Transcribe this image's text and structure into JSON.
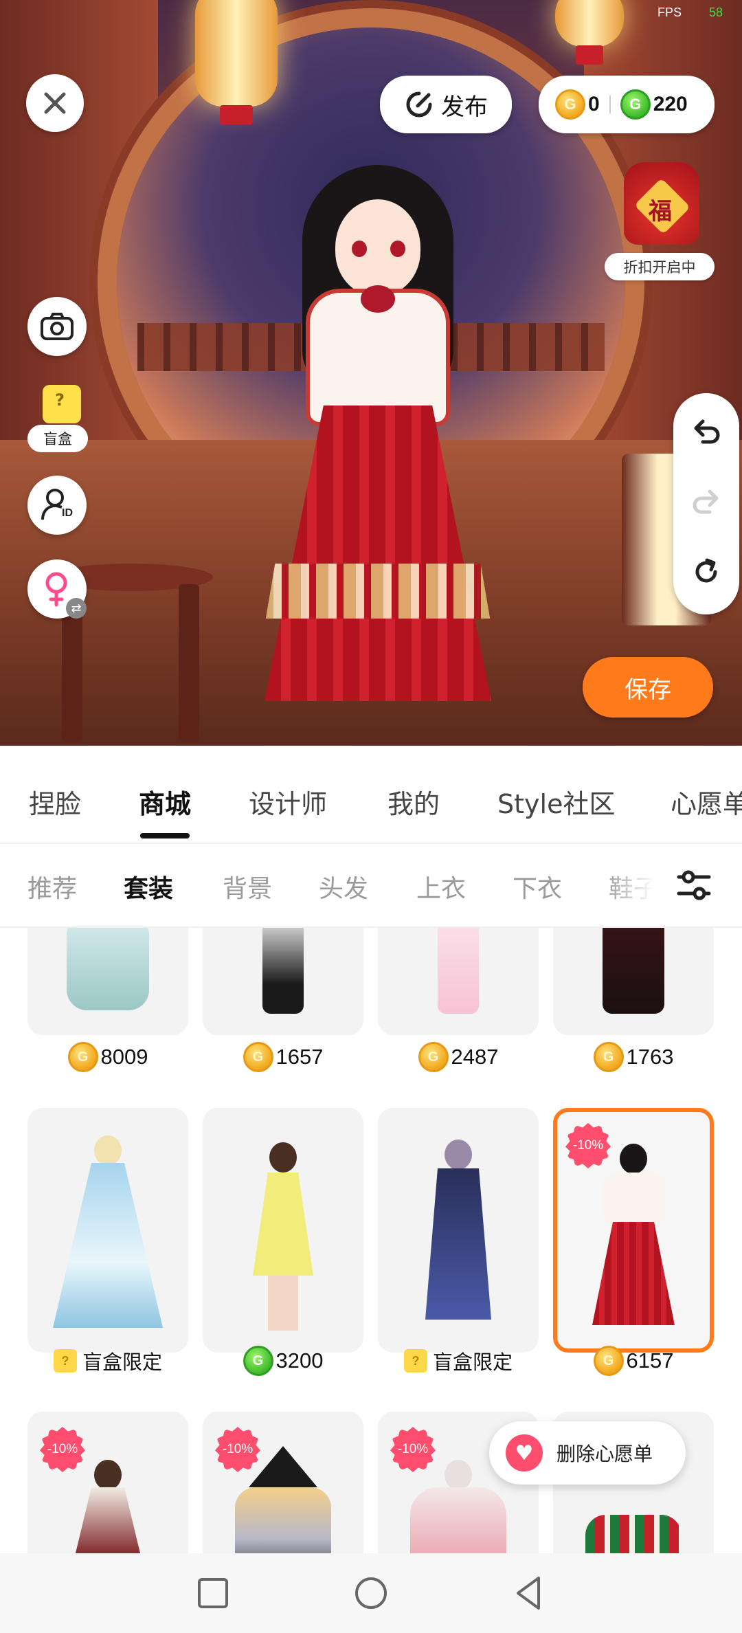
{
  "status": {
    "fps_label": "FPS",
    "fps_value": "58"
  },
  "top_bar": {
    "publish_label": "发布",
    "gold_coins": "0",
    "green_coins": "220",
    "coin_glyph": "G"
  },
  "promo": {
    "discount_label": "折扣开启中",
    "fu_char": "福"
  },
  "left_tools": {
    "blindbox_label": "盲盒",
    "blindbox_glyph": "?",
    "id_glyph": "ID"
  },
  "save_label": "保存",
  "main_tabs": [
    "捏脸",
    "商城",
    "设计师",
    "我的",
    "Style社区",
    "心愿单"
  ],
  "sub_tabs": [
    "推荐",
    "套装",
    "背景",
    "头发",
    "上衣",
    "下衣",
    "鞋子"
  ],
  "grid": {
    "row1_prices": [
      "8009",
      "1657",
      "2487",
      "1763"
    ],
    "row2_items": [
      {
        "type": "blindbox",
        "label": "盲盒限定"
      },
      {
        "type": "green",
        "label": "3200"
      },
      {
        "type": "blindbox",
        "label": "盲盒限定"
      },
      {
        "type": "gold",
        "label": "6157",
        "discount": "-10%"
      }
    ],
    "row3_discounts": [
      "-10%",
      "-10%",
      "-10%"
    ]
  },
  "wishlist_toast": {
    "label": "删除心愿单"
  },
  "colors": {
    "accent": "#ff7a1a",
    "discount": "#ff4d6d",
    "gold_coin": "#f2a81d",
    "green_coin": "#3dbb2c"
  },
  "icons": [
    "close-icon",
    "publish-icon",
    "gold-coin-icon",
    "green-coin-icon",
    "camera-icon",
    "blindbox-icon",
    "id-icon",
    "gender-switch-icon",
    "undo-icon",
    "redo-icon",
    "reset-icon",
    "filter-icon",
    "heart-icon",
    "recents-icon",
    "home-icon",
    "back-icon"
  ]
}
